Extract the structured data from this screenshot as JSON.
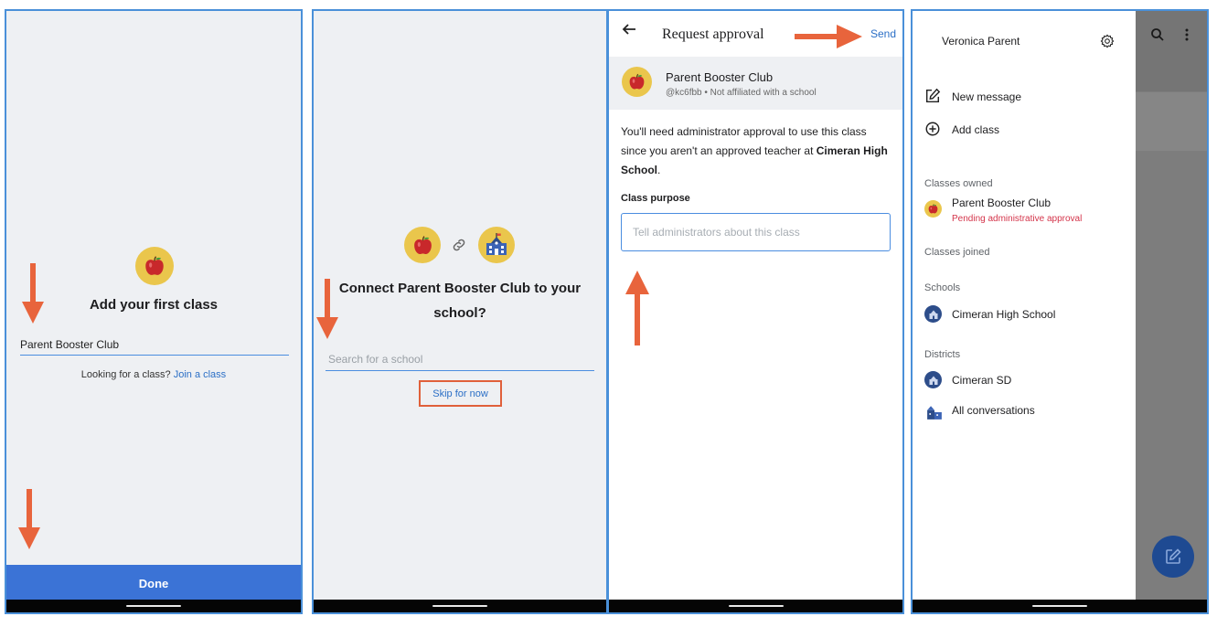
{
  "panel1": {
    "title": "Add your first class",
    "class_name_value": "Parent Booster Club",
    "looking_text": "Looking for a class?",
    "join_link": "Join a class",
    "done_label": "Done"
  },
  "panel2": {
    "title": "Connect Parent Booster Club to your school?",
    "search_placeholder": "Search for a school",
    "skip_label": "Skip for now"
  },
  "panel3": {
    "header_title": "Request approval",
    "send_label": "Send",
    "class_name": "Parent Booster Club",
    "class_sub": "@kc6fbb • Not affiliated with a school",
    "para_before": "You'll need administrator approval to use this class since you aren't an approved teacher at ",
    "para_school": "Cimeran High School",
    "para_after": ".",
    "purpose_label": "Class purpose",
    "purpose_placeholder": "Tell administrators about this class"
  },
  "panel4": {
    "user_name": "Veronica Parent",
    "new_message": "New message",
    "add_class": "Add class",
    "classes_owned_label": "Classes owned",
    "owned_class_name": "Parent Booster Club",
    "owned_class_status": "Pending administrative approval",
    "classes_joined_label": "Classes joined",
    "schools_label": "Schools",
    "school_name": "Cimeran High School",
    "districts_label": "Districts",
    "district_name": "Cimeran SD",
    "all_conversations": "All conversations"
  },
  "colors": {
    "accent_blue": "#3b73d6",
    "link_blue": "#2b6fc6",
    "arrow_orange": "#e8643c",
    "pending_red": "#d4344a",
    "apple_yellow": "#eac64c",
    "school_navy": "#2d4d8a",
    "panel_border": "#4a90d9"
  },
  "icons": {
    "apple": "apple-icon",
    "link": "link-icon",
    "school": "school-icon",
    "back": "arrow-left-icon",
    "edit": "edit-icon",
    "add": "plus-circle-icon",
    "settings": "gear-icon",
    "search": "search-icon",
    "more": "more-vert-icon",
    "conversations": "buildings-icon",
    "compose": "compose-icon"
  }
}
